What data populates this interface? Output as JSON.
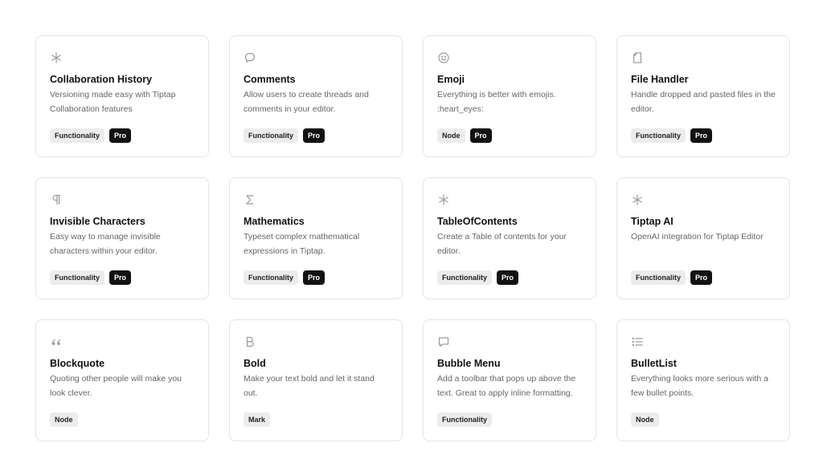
{
  "cards": [
    {
      "icon": "asterisk-icon",
      "title": "Collaboration History",
      "desc": "Versioning made easy with Tiptap Collaboration features",
      "tags": [
        "Functionality",
        "Pro"
      ]
    },
    {
      "icon": "speech-bubble-icon",
      "title": "Comments",
      "desc": "Allow users to create threads and comments in your editor.",
      "tags": [
        "Functionality",
        "Pro"
      ]
    },
    {
      "icon": "smiley-icon",
      "title": "Emoji",
      "desc": "Everything is better with emojis. :heart_eyes:",
      "tags": [
        "Node",
        "Pro"
      ]
    },
    {
      "icon": "file-icon",
      "title": "File Handler",
      "desc": "Handle dropped and pasted files in the editor.",
      "tags": [
        "Functionality",
        "Pro"
      ]
    },
    {
      "icon": "pilcrow-icon",
      "title": "Invisible Characters",
      "desc": "Easy way to manage invisible characters within your editor.",
      "tags": [
        "Functionality",
        "Pro"
      ]
    },
    {
      "icon": "sigma-icon",
      "title": "Mathematics",
      "desc": "Typeset complex mathematical expressions in Tiptap.",
      "tags": [
        "Functionality",
        "Pro"
      ]
    },
    {
      "icon": "asterisk-icon",
      "title": "TableOfContents",
      "desc": "Create a Table of contents for your editor.",
      "tags": [
        "Functionality",
        "Pro"
      ]
    },
    {
      "icon": "asterisk-icon",
      "title": "Tiptap AI",
      "desc": "OpenAI integration for Tiptap Editor",
      "tags": [
        "Functionality",
        "Pro"
      ]
    },
    {
      "icon": "quote-icon",
      "title": "Blockquote",
      "desc": "Quoting other people will make you look clever.",
      "tags": [
        "Node"
      ]
    },
    {
      "icon": "bold-icon",
      "title": "Bold",
      "desc": "Make your text bold and let it stand out.",
      "tags": [
        "Mark"
      ]
    },
    {
      "icon": "message-square-icon",
      "title": "Bubble Menu",
      "desc": "Add a toolbar that pops up above the text. Great to apply inline formatting.",
      "tags": [
        "Functionality"
      ]
    },
    {
      "icon": "list-icon",
      "title": "BulletList",
      "desc": "Everything looks more serious with a few bullet points.",
      "tags": [
        "Node"
      ]
    }
  ],
  "colors": {
    "pro_tag_bg": "#121212",
    "tag_bg": "#ececec",
    "icon": "#9a9a9a",
    "border": "#e4e4e4"
  }
}
